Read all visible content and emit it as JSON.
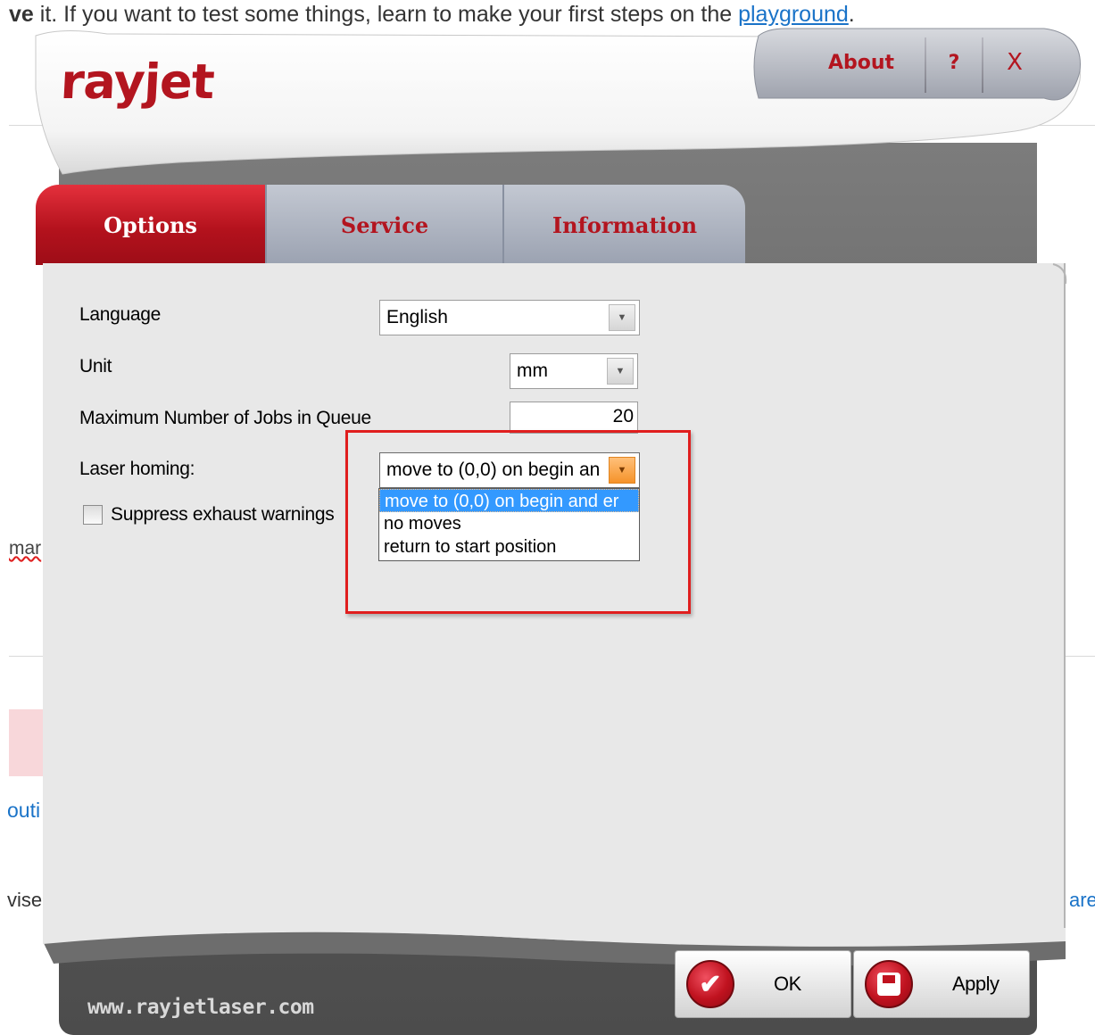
{
  "background_page": {
    "line1_bold": "ve",
    "line1_text": " it. If you want to test some things, learn to make your first steps on the ",
    "line1_link": "playground",
    "line1_end": ".",
    "frag_mar": "mar",
    "frag_outi": "outi",
    "frag_vise": "vise",
    "frag_are": "are"
  },
  "dialog": {
    "logo": "rayjet",
    "about_label": "About",
    "help_label": "?",
    "close_label": "X",
    "tabs": [
      {
        "label": "Options",
        "active": true
      },
      {
        "label": "Service",
        "active": false
      },
      {
        "label": "Information",
        "active": false
      }
    ],
    "options": {
      "language_label": "Language",
      "language_value": "English",
      "unit_label": "Unit",
      "unit_value": "mm",
      "max_jobs_label": "Maximum Number of Jobs in Queue",
      "max_jobs_value": "20",
      "homing_label": "Laser homing:",
      "homing_value": "move to (0,0) on begin an",
      "homing_options": [
        "move to (0,0) on begin and er",
        "no moves",
        "return to start position"
      ],
      "homing_selected_index": 0,
      "suppress_label": "Suppress exhaust warnings",
      "suppress_checked": false
    },
    "ok_label": "OK",
    "apply_label": "Apply",
    "footer_url": "www.rayjetlaser.com"
  },
  "colors": {
    "brand_red": "#b3151f",
    "selection_blue": "#3399ff",
    "annotation_red": "#e01e1e",
    "dropdown_orange": "#f5932a"
  }
}
